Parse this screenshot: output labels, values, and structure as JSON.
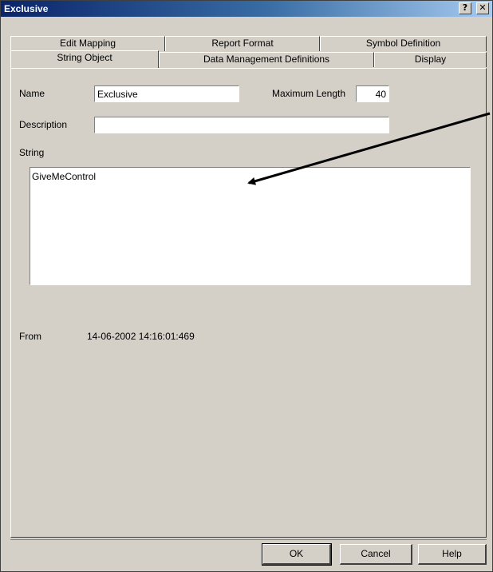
{
  "window": {
    "title": "Exclusive"
  },
  "titlebar_buttons": {
    "help": "?",
    "close": "✕"
  },
  "tabs_back": [
    "Edit Mapping",
    "Report Format",
    "Symbol Definition"
  ],
  "tabs_front": [
    "String Object",
    "Data Management Definitions",
    "Display"
  ],
  "active_tab": "String Object",
  "form": {
    "name_label": "Name",
    "name_value": "Exclusive",
    "max_length_label": "Maximum Length",
    "max_length_value": "40",
    "description_label": "Description",
    "description_value": "",
    "string_label": "String",
    "string_value": "GiveMeControl",
    "from_label": "From",
    "from_value": "14-06-2002 14:16:01:469"
  },
  "buttons": {
    "ok": "OK",
    "cancel": "Cancel",
    "help": "Help"
  },
  "colors": {
    "face": "#d4d0c8",
    "title_start": "#0a246a",
    "title_end": "#a6caf0"
  }
}
